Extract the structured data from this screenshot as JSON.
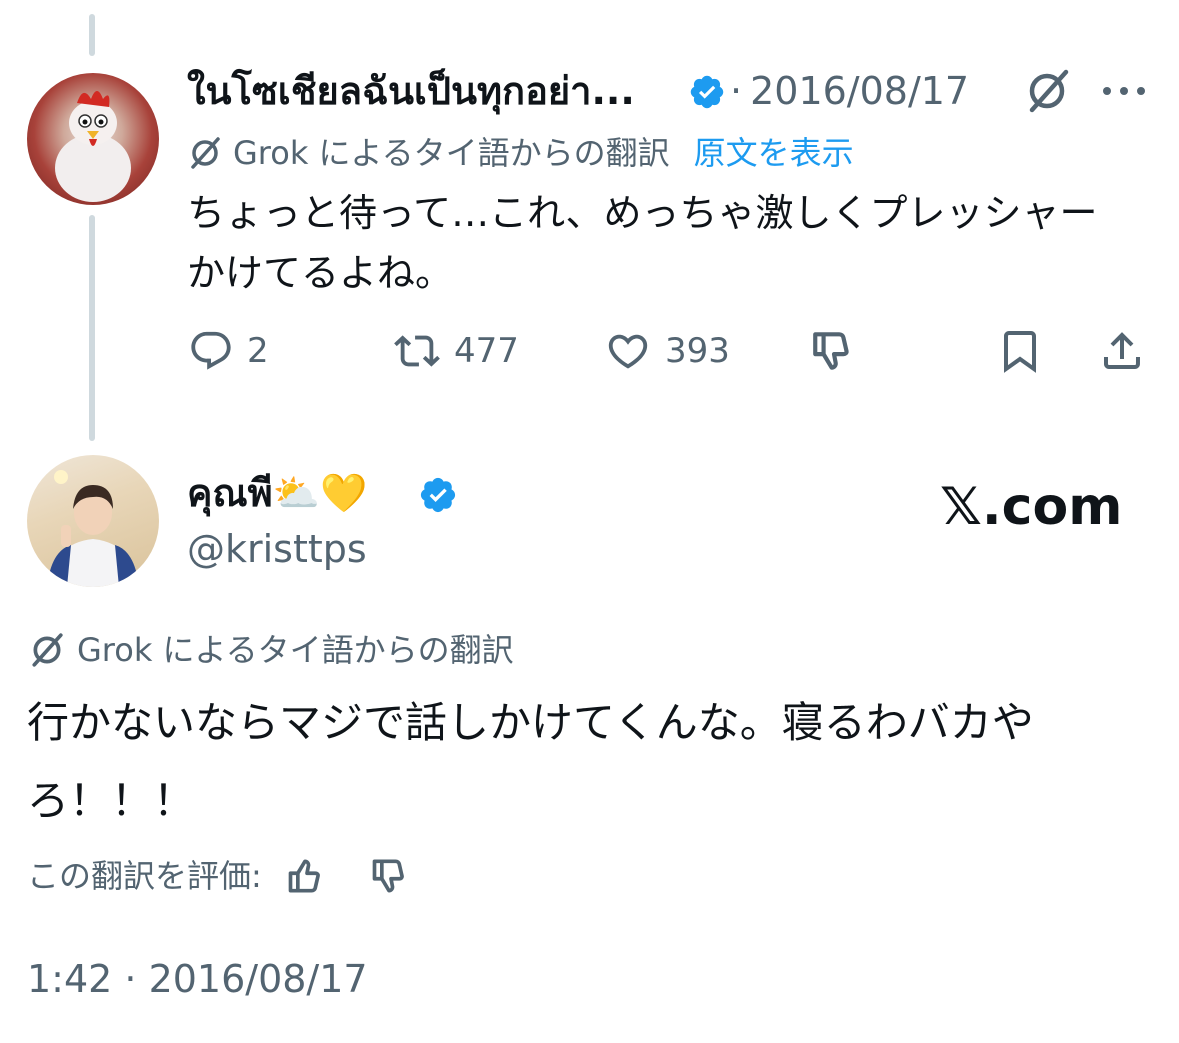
{
  "tweet1": {
    "author_name": "ในโซเชียลฉันเป็นทุกอย่า...",
    "separator": "·",
    "date": "2016/08/17",
    "translation_label": "Grok によるタイ語からの翻訳",
    "show_original": "原文を表示",
    "text": "ちょっと待って…これ、めっちゃ激しくプレッシャーかけてるよね。",
    "actions": {
      "replies": "2",
      "retweets": "477",
      "likes": "393"
    }
  },
  "tweet2": {
    "author_name": "คุณพี⛅💛",
    "handle": "@kristtps",
    "translation_label": "Grok によるタイ語からの翻訳",
    "text": "行かないならマジで話しかけてくんな。寝るわバカやろ！！！",
    "rate_label": "この翻訳を評価:",
    "timestamp": "1:42 · 2016/08/17"
  },
  "branding": {
    "logo": "𝕏.com"
  },
  "colors": {
    "verified": "#1d9bf0",
    "gray": "#536471",
    "link": "#1d9bf0",
    "thread_line": "#cfd9de"
  },
  "icons": [
    "grok-icon",
    "more-icon",
    "reply-icon",
    "retweet-icon",
    "like-icon",
    "dislike-icon",
    "bookmark-icon",
    "share-icon",
    "verified-badge-icon",
    "thumbs-up-icon",
    "thumbs-down-icon"
  ]
}
